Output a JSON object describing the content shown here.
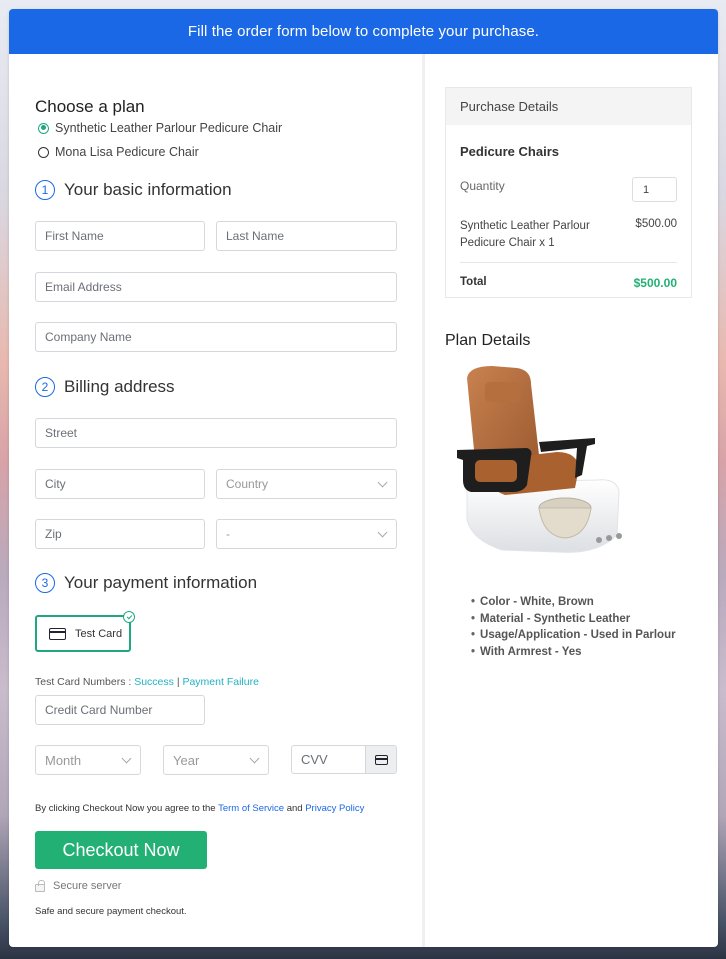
{
  "banner": {
    "text": "Fill the order form below to complete your purchase."
  },
  "plan": {
    "heading": "Choose a plan",
    "options": [
      {
        "label": "Synthetic Leather Parlour Pedicure Chair",
        "selected": true
      },
      {
        "label": "Mona Lisa Pedicure Chair",
        "selected": false
      }
    ]
  },
  "basic_info": {
    "step": "1",
    "heading": "Your basic information",
    "first_name_placeholder": "First Name",
    "last_name_placeholder": "Last Name",
    "email_placeholder": "Email Address",
    "company_placeholder": "Company Name"
  },
  "billing": {
    "step": "2",
    "heading": "Billing address",
    "street_placeholder": "Street",
    "city_placeholder": "City",
    "country_value": "Country",
    "zip_placeholder": "Zip",
    "state_value": "-"
  },
  "payment": {
    "step": "3",
    "heading": "Your payment information",
    "method_label": "Test Card",
    "test_numbers_label": "Test Card Numbers :",
    "success_link": "Success",
    "separator": "|",
    "failure_link": "Payment Failure",
    "card_number_placeholder": "Credit Card Number",
    "month_value": "Month",
    "year_value": "Year",
    "cvv_placeholder": "CVV"
  },
  "terms": {
    "prefix": "By clicking Checkout Now you agree to the",
    "tos_link": "Term of Service",
    "and": "and",
    "privacy_link": "Privacy Policy"
  },
  "checkout": {
    "button_label": "Checkout Now",
    "secure_label": "Secure server",
    "safe_text": "Safe and secure payment checkout."
  },
  "purchase_details": {
    "heading": "Purchase Details",
    "product_group": "Pedicure Chairs",
    "quantity_label": "Quantity",
    "quantity_value": "1",
    "item_name": "Synthetic Leather Parlour Pedicure Chair x 1",
    "item_price": "$500.00",
    "total_label": "Total",
    "total_value": "$500.00"
  },
  "plan_details": {
    "heading": "Plan Details",
    "image_alt": "Pedicure chair with brown synthetic leather seat and white basin",
    "features": [
      "Color - White, Brown",
      "Material - Synthetic Leather",
      "Usage/Application - Used in Parlour",
      "With Armrest - Yes"
    ]
  },
  "colors": {
    "brand_blue": "#1a68e6",
    "success_green": "#23b074",
    "link_teal": "#20b3c2"
  }
}
